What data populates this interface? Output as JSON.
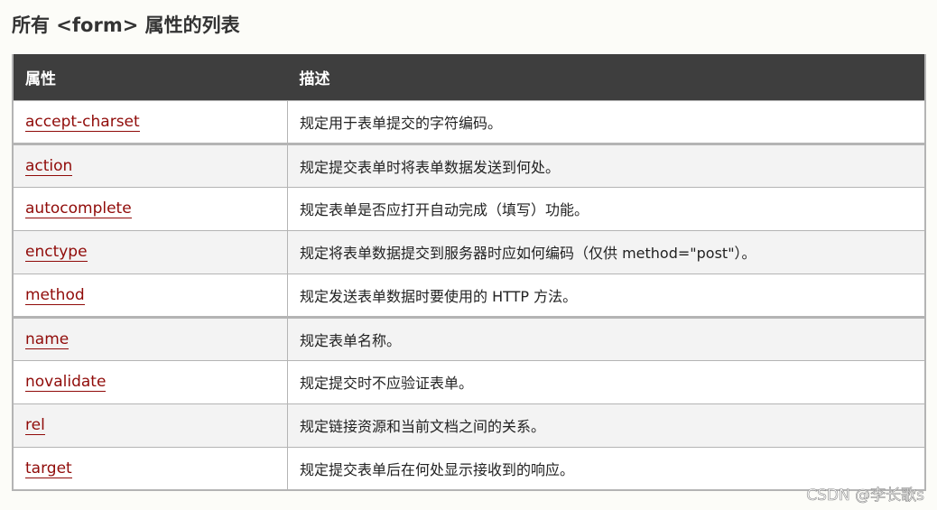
{
  "title": "所有 <form> 属性的列表",
  "table": {
    "headers": [
      "属性",
      "描述"
    ],
    "rows": [
      {
        "attr": "accept-charset",
        "desc": "规定用于表单提交的字符编码。"
      },
      {
        "attr": "action",
        "desc": "规定提交表单时将表单数据发送到何处。"
      },
      {
        "attr": "autocomplete",
        "desc": "规定表单是否应打开自动完成（填写）功能。"
      },
      {
        "attr": "enctype",
        "desc": "规定将表单数据提交到服务器时应如何编码（仅供 method=\"post\"）。"
      },
      {
        "attr": "method",
        "desc": "规定发送表单数据时要使用的 HTTP 方法。"
      },
      {
        "attr": "name",
        "desc": "规定表单名称。"
      },
      {
        "attr": "novalidate",
        "desc": "规定提交时不应验证表单。"
      },
      {
        "attr": "rel",
        "desc": "规定链接资源和当前文档之间的关系。"
      },
      {
        "attr": "target",
        "desc": "规定提交表单后在何处显示接收到的响应。"
      }
    ]
  },
  "watermark": "CSDN @李长歌s",
  "colors": {
    "header_bg": "#3e3e3e",
    "link": "#900b09",
    "row_alt": "#f3f3f3",
    "border": "#b4b4b4"
  }
}
